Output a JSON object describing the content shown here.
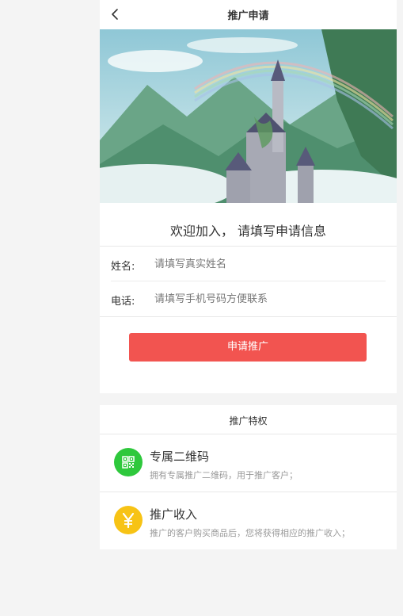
{
  "navbar": {
    "title": "推广申请",
    "back_icon": "chevron-left-icon"
  },
  "form": {
    "welcome": "欢迎加入， 请填写申请信息",
    "name_label": "姓名:",
    "name_placeholder": "请填写真实姓名",
    "name_value": "",
    "phone_label": "电话:",
    "phone_placeholder": "请填写手机号码方便联系",
    "phone_value": "",
    "submit_label": "申请推广"
  },
  "privileges": {
    "title": "推广特权",
    "items": [
      {
        "name": "专属二维码",
        "desc": "拥有专属推广二维码，用于推广客户；",
        "icon": "qr-code-icon",
        "color": "#2ec83c"
      },
      {
        "name": "推广收入",
        "desc": "推广的客户购买商品后，您将获得相应的推广收入；",
        "icon": "yen-icon",
        "color": "#f7c315"
      }
    ]
  },
  "colors": {
    "accent": "#f25450",
    "page_bg": "#f4f4f4"
  }
}
